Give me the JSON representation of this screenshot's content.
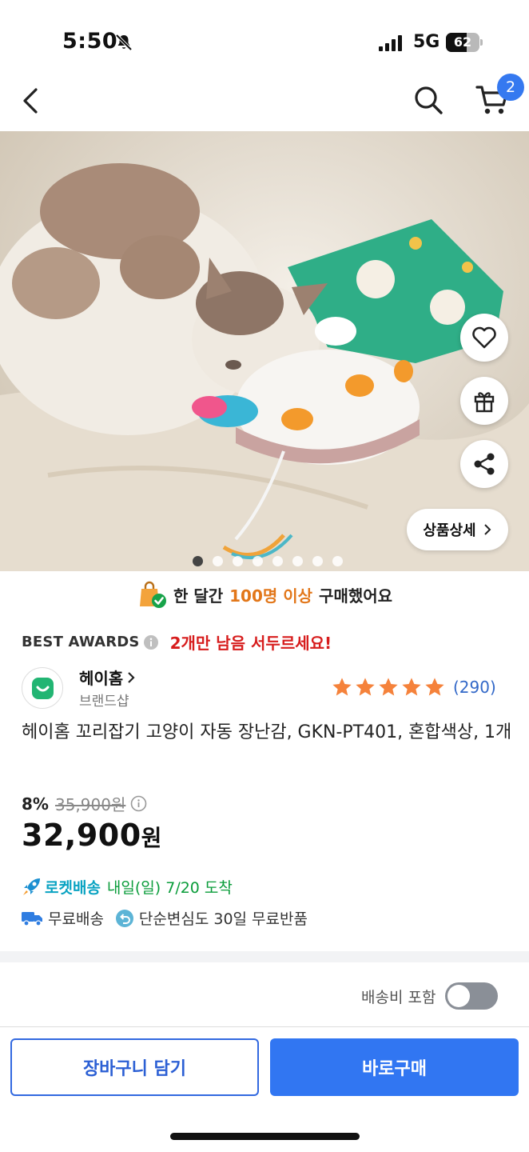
{
  "status_bar": {
    "time": "5:50",
    "network": "5G",
    "battery": "62",
    "battery_level": 0.62
  },
  "nav": {
    "cart_count": "2",
    "icons": [
      "back-icon",
      "search-icon",
      "cart-icon"
    ]
  },
  "hero": {
    "detail_button": "상품상세",
    "side_icons": [
      "heart-icon",
      "gift-icon",
      "share-icon"
    ],
    "dots_total": 8,
    "dots_active": 0
  },
  "purchase_banner": {
    "prefix": "한 달간",
    "highlight": "100명 이상",
    "suffix": "구매했어요"
  },
  "awards": {
    "title": "BEST AWARDS",
    "hurry": "2개만 남음 서두르세요!"
  },
  "brand": {
    "name": "헤이홈",
    "sub": "브랜드샵"
  },
  "rating": {
    "stars": 5,
    "count": "(290)"
  },
  "product": {
    "title": "헤이홈 꼬리잡기 고양이 자동 장난감, GKN-PT401, 혼합색상, 1개",
    "discount": "8%",
    "original_price": "35,900원",
    "price": "32,900",
    "price_unit": "원"
  },
  "delivery": {
    "rocket_label": "로켓배송",
    "arrival": "내일(일) 7/20 도착",
    "free_shipping": "무료배송",
    "returns": "단순변심도 30일 무료반품"
  },
  "shipping_toggle": {
    "label": "배송비 포함",
    "on": false
  },
  "actions": {
    "add_to_cart": "장바구니 담기",
    "buy_now": "바로구매"
  },
  "colors": {
    "accent_blue": "#3176f2",
    "rocket_teal": "#0aa3c2",
    "arrival_green": "#0a9c3a",
    "warning_red": "#d71d1d",
    "highlight_orange": "#e2771a",
    "star_orange": "#f5823b"
  }
}
